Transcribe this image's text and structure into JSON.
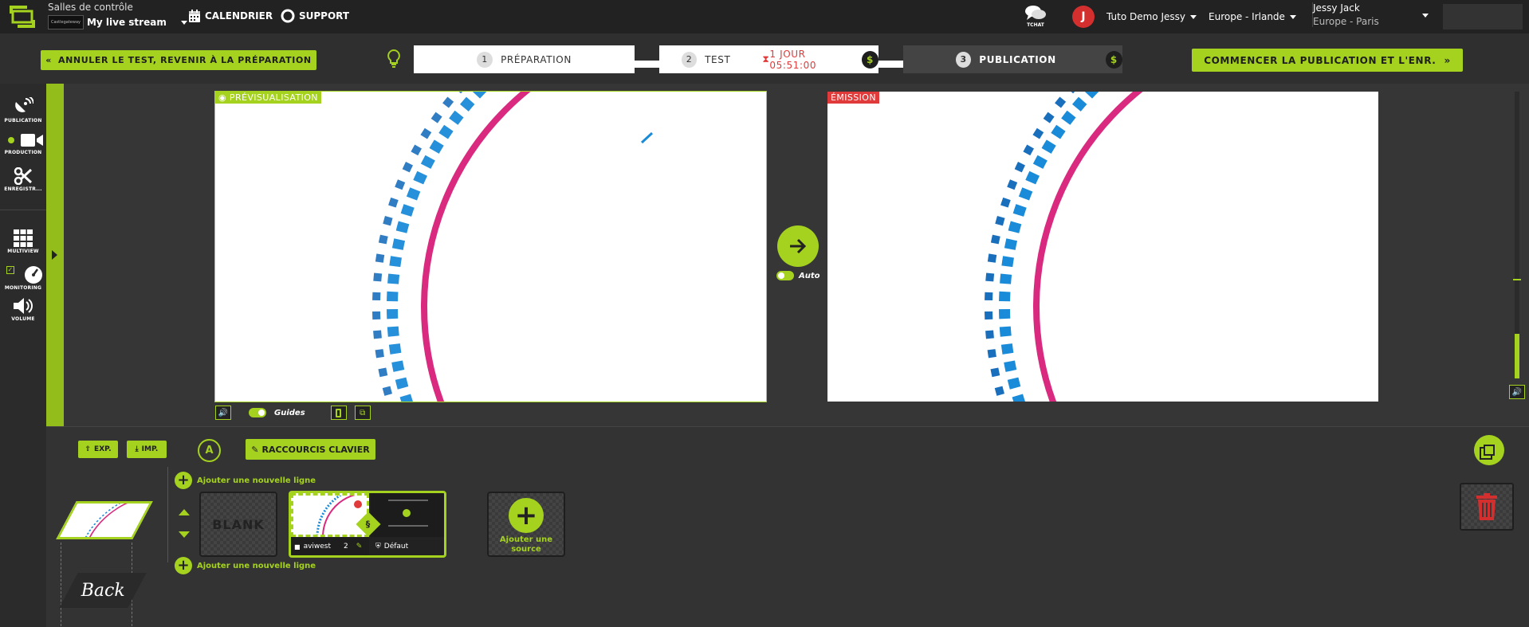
{
  "topbar": {
    "control_rooms_label": "Salles de contrôle",
    "brand_badge": "Castlegateway",
    "stream_name": "My live stream",
    "calendar_label": "CALENDRIER",
    "support_label": "SUPPORT",
    "chat_label": "TCHAT",
    "avatar_initial": "J",
    "account_name": "Tuto Demo Jessy",
    "region": "Europe - Irlande",
    "user_name": "Jessy Jack",
    "user_timezone": "Europe - Paris"
  },
  "stepbar": {
    "cancel_label": "ANNULER LE TEST, REVENIR À LA PRÉPARATION",
    "steps": [
      {
        "num": "1",
        "label": "PRÉPARATION"
      },
      {
        "num": "2",
        "label": "TEST",
        "timer": "1 JOUR 05:51:00"
      },
      {
        "num": "3",
        "label": "PUBLICATION"
      }
    ],
    "dollar_symbol": "$",
    "start_label": "COMMENCER LA PUBLICATION ET L'ENR."
  },
  "leftnav": {
    "items": [
      "PUBLICATION",
      "PRODUCTION",
      "ENREGISTR...",
      "MULTIVIEW",
      "MONITORING",
      "VOLUME"
    ]
  },
  "preview": {
    "label": "PRÉVISUALISATION",
    "guides_label": "Guides"
  },
  "program": {
    "label": "ÉMISSION",
    "auto_label": "Auto"
  },
  "bottom": {
    "export_label": "EXP.",
    "import_label": "IMP.",
    "a_label": "A",
    "shortcuts_label": "RACCOURCIS CLAVIER",
    "add_line_label": "Ajouter une nouvelle ligne",
    "blank_label": "BLANK",
    "source_name": "aviwest",
    "source_count": "2",
    "section_symbol": "§",
    "default_label": "Défaut",
    "add_source_label": "Ajouter une source",
    "back_label": "Back"
  },
  "colors": {
    "accent": "#a4d21e",
    "magenta": "#d92a7f",
    "blue": "#1a8bd8",
    "alert": "#e03a3a"
  }
}
